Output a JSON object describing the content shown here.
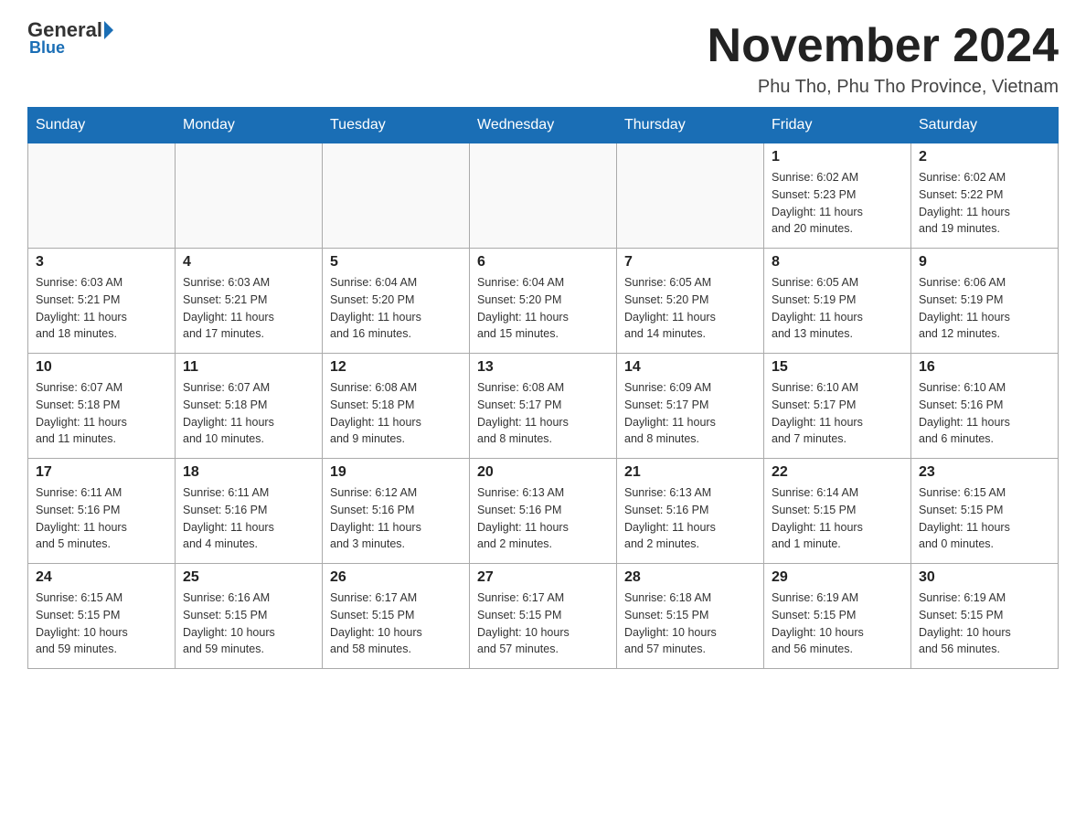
{
  "header": {
    "logo_general": "General",
    "logo_blue": "Blue",
    "month_title": "November 2024",
    "location": "Phu Tho, Phu Tho Province, Vietnam"
  },
  "days_of_week": [
    "Sunday",
    "Monday",
    "Tuesday",
    "Wednesday",
    "Thursday",
    "Friday",
    "Saturday"
  ],
  "weeks": [
    [
      {
        "day": "",
        "info": ""
      },
      {
        "day": "",
        "info": ""
      },
      {
        "day": "",
        "info": ""
      },
      {
        "day": "",
        "info": ""
      },
      {
        "day": "",
        "info": ""
      },
      {
        "day": "1",
        "info": "Sunrise: 6:02 AM\nSunset: 5:23 PM\nDaylight: 11 hours\nand 20 minutes."
      },
      {
        "day": "2",
        "info": "Sunrise: 6:02 AM\nSunset: 5:22 PM\nDaylight: 11 hours\nand 19 minutes."
      }
    ],
    [
      {
        "day": "3",
        "info": "Sunrise: 6:03 AM\nSunset: 5:21 PM\nDaylight: 11 hours\nand 18 minutes."
      },
      {
        "day": "4",
        "info": "Sunrise: 6:03 AM\nSunset: 5:21 PM\nDaylight: 11 hours\nand 17 minutes."
      },
      {
        "day": "5",
        "info": "Sunrise: 6:04 AM\nSunset: 5:20 PM\nDaylight: 11 hours\nand 16 minutes."
      },
      {
        "day": "6",
        "info": "Sunrise: 6:04 AM\nSunset: 5:20 PM\nDaylight: 11 hours\nand 15 minutes."
      },
      {
        "day": "7",
        "info": "Sunrise: 6:05 AM\nSunset: 5:20 PM\nDaylight: 11 hours\nand 14 minutes."
      },
      {
        "day": "8",
        "info": "Sunrise: 6:05 AM\nSunset: 5:19 PM\nDaylight: 11 hours\nand 13 minutes."
      },
      {
        "day": "9",
        "info": "Sunrise: 6:06 AM\nSunset: 5:19 PM\nDaylight: 11 hours\nand 12 minutes."
      }
    ],
    [
      {
        "day": "10",
        "info": "Sunrise: 6:07 AM\nSunset: 5:18 PM\nDaylight: 11 hours\nand 11 minutes."
      },
      {
        "day": "11",
        "info": "Sunrise: 6:07 AM\nSunset: 5:18 PM\nDaylight: 11 hours\nand 10 minutes."
      },
      {
        "day": "12",
        "info": "Sunrise: 6:08 AM\nSunset: 5:18 PM\nDaylight: 11 hours\nand 9 minutes."
      },
      {
        "day": "13",
        "info": "Sunrise: 6:08 AM\nSunset: 5:17 PM\nDaylight: 11 hours\nand 8 minutes."
      },
      {
        "day": "14",
        "info": "Sunrise: 6:09 AM\nSunset: 5:17 PM\nDaylight: 11 hours\nand 8 minutes."
      },
      {
        "day": "15",
        "info": "Sunrise: 6:10 AM\nSunset: 5:17 PM\nDaylight: 11 hours\nand 7 minutes."
      },
      {
        "day": "16",
        "info": "Sunrise: 6:10 AM\nSunset: 5:16 PM\nDaylight: 11 hours\nand 6 minutes."
      }
    ],
    [
      {
        "day": "17",
        "info": "Sunrise: 6:11 AM\nSunset: 5:16 PM\nDaylight: 11 hours\nand 5 minutes."
      },
      {
        "day": "18",
        "info": "Sunrise: 6:11 AM\nSunset: 5:16 PM\nDaylight: 11 hours\nand 4 minutes."
      },
      {
        "day": "19",
        "info": "Sunrise: 6:12 AM\nSunset: 5:16 PM\nDaylight: 11 hours\nand 3 minutes."
      },
      {
        "day": "20",
        "info": "Sunrise: 6:13 AM\nSunset: 5:16 PM\nDaylight: 11 hours\nand 2 minutes."
      },
      {
        "day": "21",
        "info": "Sunrise: 6:13 AM\nSunset: 5:16 PM\nDaylight: 11 hours\nand 2 minutes."
      },
      {
        "day": "22",
        "info": "Sunrise: 6:14 AM\nSunset: 5:15 PM\nDaylight: 11 hours\nand 1 minute."
      },
      {
        "day": "23",
        "info": "Sunrise: 6:15 AM\nSunset: 5:15 PM\nDaylight: 11 hours\nand 0 minutes."
      }
    ],
    [
      {
        "day": "24",
        "info": "Sunrise: 6:15 AM\nSunset: 5:15 PM\nDaylight: 10 hours\nand 59 minutes."
      },
      {
        "day": "25",
        "info": "Sunrise: 6:16 AM\nSunset: 5:15 PM\nDaylight: 10 hours\nand 59 minutes."
      },
      {
        "day": "26",
        "info": "Sunrise: 6:17 AM\nSunset: 5:15 PM\nDaylight: 10 hours\nand 58 minutes."
      },
      {
        "day": "27",
        "info": "Sunrise: 6:17 AM\nSunset: 5:15 PM\nDaylight: 10 hours\nand 57 minutes."
      },
      {
        "day": "28",
        "info": "Sunrise: 6:18 AM\nSunset: 5:15 PM\nDaylight: 10 hours\nand 57 minutes."
      },
      {
        "day": "29",
        "info": "Sunrise: 6:19 AM\nSunset: 5:15 PM\nDaylight: 10 hours\nand 56 minutes."
      },
      {
        "day": "30",
        "info": "Sunrise: 6:19 AM\nSunset: 5:15 PM\nDaylight: 10 hours\nand 56 minutes."
      }
    ]
  ]
}
